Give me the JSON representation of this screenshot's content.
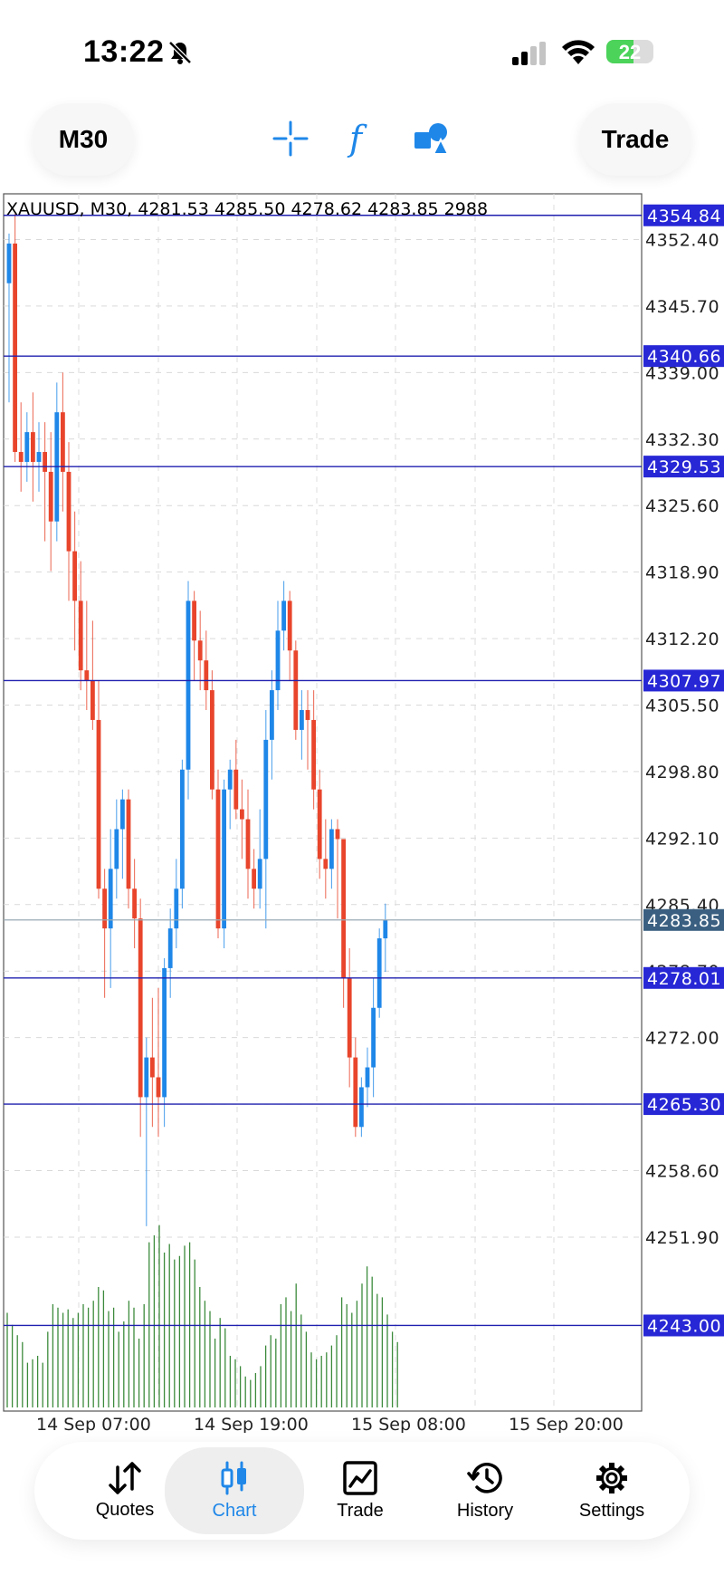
{
  "status_bar": {
    "time": "13:22",
    "battery": "22",
    "icons": [
      "bell-slash-icon",
      "signal-icon",
      "wifi-icon",
      "battery-icon"
    ]
  },
  "toolbar": {
    "timeframe": "M30",
    "trade_label": "Trade",
    "icons": [
      "crosshair-icon",
      "indicators-icon",
      "objects-icon"
    ]
  },
  "chart": {
    "header": "XAUUSD, M30, 4281.53 4285.50 4278.62 4283.85 2988",
    "accent_color": "#1f87e8",
    "bear_color": "#e8452c",
    "line_color": "#2020b0",
    "current_price": "4283.85",
    "price_levels": [
      "4352.40",
      "4345.70",
      "4339.00",
      "4332.30",
      "4325.60",
      "4318.90",
      "4312.20",
      "4305.50",
      "4298.80",
      "4292.10",
      "4285.40",
      "4278.70",
      "4272.00",
      "4265.30",
      "4258.60",
      "4251.90"
    ],
    "horizontal_lines": [
      "4354.84",
      "4340.66",
      "4329.53",
      "4307.97",
      "4278.01",
      "4265.30",
      "4243.00"
    ],
    "time_labels": [
      "14 Sep 07:00",
      "14 Sep 19:00",
      "15 Sep 08:00",
      "15 Sep 20:00"
    ]
  },
  "chart_data": {
    "type": "candlestick",
    "symbol": "XAUUSD",
    "timeframe": "M30",
    "ylim": [
      4240,
      4357
    ],
    "candles": [
      {
        "o": 4348,
        "h": 4353,
        "l": 4336,
        "c": 4352
      },
      {
        "o": 4352,
        "h": 4355,
        "l": 4330,
        "c": 4331
      },
      {
        "o": 4331,
        "h": 4336,
        "l": 4327,
        "c": 4330
      },
      {
        "o": 4330,
        "h": 4335,
        "l": 4328,
        "c": 4333
      },
      {
        "o": 4333,
        "h": 4337,
        "l": 4326,
        "c": 4330
      },
      {
        "o": 4330,
        "h": 4334,
        "l": 4327,
        "c": 4331
      },
      {
        "o": 4331,
        "h": 4334,
        "l": 4322,
        "c": 4329
      },
      {
        "o": 4329,
        "h": 4333,
        "l": 4319,
        "c": 4324
      },
      {
        "o": 4324,
        "h": 4338,
        "l": 4322,
        "c": 4335
      },
      {
        "o": 4335,
        "h": 4339,
        "l": 4325,
        "c": 4329
      },
      {
        "o": 4329,
        "h": 4332,
        "l": 4316,
        "c": 4321
      },
      {
        "o": 4321,
        "h": 4325,
        "l": 4311,
        "c": 4316
      },
      {
        "o": 4316,
        "h": 4320,
        "l": 4307,
        "c": 4309
      },
      {
        "o": 4309,
        "h": 4316,
        "l": 4305,
        "c": 4308
      },
      {
        "o": 4308,
        "h": 4314,
        "l": 4303,
        "c": 4304
      },
      {
        "o": 4304,
        "h": 4308,
        "l": 4286,
        "c": 4287
      },
      {
        "o": 4287,
        "h": 4289,
        "l": 4276,
        "c": 4283
      },
      {
        "o": 4283,
        "h": 4293,
        "l": 4277,
        "c": 4289
      },
      {
        "o": 4289,
        "h": 4296,
        "l": 4286,
        "c": 4293
      },
      {
        "o": 4293,
        "h": 4297,
        "l": 4288,
        "c": 4296
      },
      {
        "o": 4296,
        "h": 4297,
        "l": 4285,
        "c": 4287
      },
      {
        "o": 4287,
        "h": 4290,
        "l": 4281,
        "c": 4284
      },
      {
        "o": 4284,
        "h": 4286,
        "l": 4262,
        "c": 4266
      },
      {
        "o": 4266,
        "h": 4272,
        "l": 4253,
        "c": 4270
      },
      {
        "o": 4270,
        "h": 4276,
        "l": 4263,
        "c": 4268
      },
      {
        "o": 4268,
        "h": 4277,
        "l": 4262,
        "c": 4266
      },
      {
        "o": 4266,
        "h": 4280,
        "l": 4263,
        "c": 4279
      },
      {
        "o": 4279,
        "h": 4285,
        "l": 4276,
        "c": 4283
      },
      {
        "o": 4283,
        "h": 4290,
        "l": 4281,
        "c": 4287
      },
      {
        "o": 4287,
        "h": 4300,
        "l": 4285,
        "c": 4299
      },
      {
        "o": 4299,
        "h": 4318,
        "l": 4296,
        "c": 4316
      },
      {
        "o": 4316,
        "h": 4317,
        "l": 4308,
        "c": 4312
      },
      {
        "o": 4312,
        "h": 4315,
        "l": 4307,
        "c": 4310
      },
      {
        "o": 4310,
        "h": 4313,
        "l": 4305,
        "c": 4307
      },
      {
        "o": 4307,
        "h": 4309,
        "l": 4296,
        "c": 4297
      },
      {
        "o": 4297,
        "h": 4299,
        "l": 4282,
        "c": 4283
      },
      {
        "o": 4283,
        "h": 4298,
        "l": 4281,
        "c": 4297
      },
      {
        "o": 4297,
        "h": 4300,
        "l": 4293,
        "c": 4299
      },
      {
        "o": 4299,
        "h": 4302,
        "l": 4294,
        "c": 4295
      },
      {
        "o": 4295,
        "h": 4298,
        "l": 4290,
        "c": 4294
      },
      {
        "o": 4294,
        "h": 4297,
        "l": 4286,
        "c": 4289
      },
      {
        "o": 4289,
        "h": 4291,
        "l": 4285,
        "c": 4287
      },
      {
        "o": 4287,
        "h": 4295,
        "l": 4285,
        "c": 4290
      },
      {
        "o": 4290,
        "h": 4305,
        "l": 4283,
        "c": 4302
      },
      {
        "o": 4302,
        "h": 4309,
        "l": 4298,
        "c": 4307
      },
      {
        "o": 4307,
        "h": 4316,
        "l": 4305,
        "c": 4313
      },
      {
        "o": 4313,
        "h": 4318,
        "l": 4311,
        "c": 4316
      },
      {
        "o": 4316,
        "h": 4317,
        "l": 4308,
        "c": 4311
      },
      {
        "o": 4311,
        "h": 4312,
        "l": 4302,
        "c": 4303
      },
      {
        "o": 4303,
        "h": 4307,
        "l": 4300,
        "c": 4305
      },
      {
        "o": 4305,
        "h": 4307,
        "l": 4299,
        "c": 4304
      },
      {
        "o": 4304,
        "h": 4307,
        "l": 4295,
        "c": 4297
      },
      {
        "o": 4297,
        "h": 4299,
        "l": 4288,
        "c": 4290
      },
      {
        "o": 4290,
        "h": 4294,
        "l": 4286,
        "c": 4289
      },
      {
        "o": 4289,
        "h": 4294,
        "l": 4287,
        "c": 4293
      },
      {
        "o": 4293,
        "h": 4294,
        "l": 4284,
        "c": 4292
      },
      {
        "o": 4292,
        "h": 4292,
        "l": 4275,
        "c": 4278
      },
      {
        "o": 4278,
        "h": 4281,
        "l": 4267,
        "c": 4270
      },
      {
        "o": 4270,
        "h": 4272,
        "l": 4262,
        "c": 4263
      },
      {
        "o": 4263,
        "h": 4268,
        "l": 4262,
        "c": 4267
      },
      {
        "o": 4267,
        "h": 4271,
        "l": 4265,
        "c": 4269
      },
      {
        "o": 4269,
        "h": 4278,
        "l": 4266,
        "c": 4275
      },
      {
        "o": 4275,
        "h": 4283,
        "l": 4274,
        "c": 4282
      },
      {
        "o": 4282,
        "h": 4285.5,
        "l": 4278.62,
        "c": 4283.85
      }
    ],
    "volumes": [
      55,
      48,
      42,
      38,
      26,
      28,
      30,
      26,
      44,
      60,
      58,
      55,
      57,
      52,
      55,
      60,
      58,
      62,
      70,
      68,
      56,
      58,
      44,
      50,
      62,
      58,
      40,
      60,
      96,
      100,
      106,
      90,
      95,
      86,
      88,
      94,
      96,
      86,
      70,
      62,
      56,
      40,
      52,
      46,
      30,
      28,
      24,
      18,
      16,
      20,
      24,
      36,
      42,
      40,
      60,
      64,
      56,
      72,
      54,
      44,
      32,
      28,
      30,
      32,
      36,
      42,
      64,
      60,
      55,
      62,
      72,
      82,
      76,
      66,
      64,
      54,
      44,
      38
    ],
    "volume_color": "#3c8a3c"
  },
  "navigation": {
    "items": [
      {
        "label": "Quotes",
        "icon": "quotes-icon"
      },
      {
        "label": "Chart",
        "icon": "chart-icon"
      },
      {
        "label": "Trade",
        "icon": "trade-icon"
      },
      {
        "label": "History",
        "icon": "history-icon"
      },
      {
        "label": "Settings",
        "icon": "settings-icon"
      }
    ],
    "active": "Chart"
  }
}
